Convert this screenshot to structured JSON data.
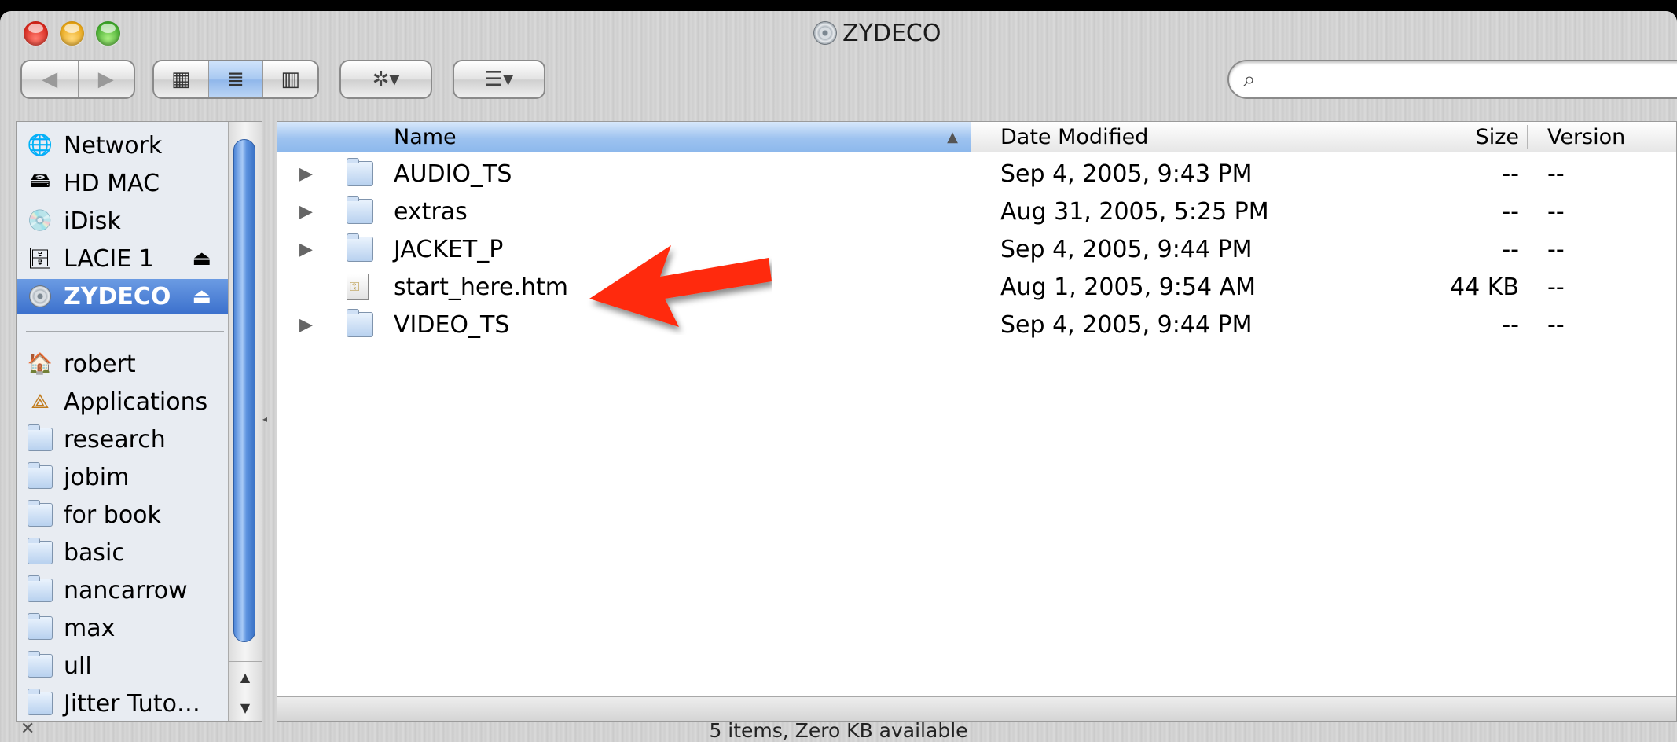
{
  "window": {
    "title": "ZYDECO",
    "status": "5 items, Zero KB available"
  },
  "toolbar": {
    "back_icon": "◀",
    "forward_icon": "▶",
    "icon_view": "▦",
    "list_view": "≣",
    "column_view": "▥",
    "action_icon": "✲▾",
    "arrange_icon": "☰▾",
    "search_placeholder": ""
  },
  "sidebar": {
    "devices": [
      {
        "label": "Network",
        "icon": "network-globe-icon"
      },
      {
        "label": "HD MAC",
        "icon": "hard-drive-icon"
      },
      {
        "label": "iDisk",
        "icon": "idisk-icon"
      },
      {
        "label": "LACIE 1",
        "icon": "usb-drive-icon",
        "eject": "⏏"
      },
      {
        "label": "ZYDECO",
        "icon": "dvd-disc-icon",
        "eject": "⏏",
        "selected": true
      }
    ],
    "places": [
      {
        "label": "robert",
        "icon": "home-icon"
      },
      {
        "label": "Applications",
        "icon": "applications-icon"
      },
      {
        "label": "research",
        "icon": "folder-icon"
      },
      {
        "label": "jobim",
        "icon": "folder-icon"
      },
      {
        "label": "for book",
        "icon": "folder-icon"
      },
      {
        "label": "basic",
        "icon": "folder-icon"
      },
      {
        "label": "nancarrow",
        "icon": "folder-icon"
      },
      {
        "label": "max",
        "icon": "folder-icon"
      },
      {
        "label": "ull",
        "icon": "folder-icon"
      },
      {
        "label": "Jitter Tuto…",
        "icon": "folder-icon"
      }
    ]
  },
  "columns": {
    "name": "Name",
    "date": "Date Modified",
    "size": "Size",
    "version": "Version"
  },
  "files": [
    {
      "name": "AUDIO_TS",
      "date": "Sep 4, 2005, 9:43 PM",
      "size": "--",
      "version": "--",
      "type": "folder"
    },
    {
      "name": "extras",
      "date": "Aug 31, 2005, 5:25 PM",
      "size": "--",
      "version": "--",
      "type": "folder"
    },
    {
      "name": "JACKET_P",
      "date": "Sep 4, 2005, 9:44 PM",
      "size": "--",
      "version": "--",
      "type": "folder"
    },
    {
      "name": "start_here.htm",
      "date": "Aug 1, 2005, 9:54 AM",
      "size": "44 KB",
      "version": "--",
      "type": "file"
    },
    {
      "name": "VIDEO_TS",
      "date": "Sep 4, 2005, 9:44 PM",
      "size": "--",
      "version": "--",
      "type": "folder"
    }
  ],
  "colors": {
    "selection": "#3c71cd",
    "annotation_arrow": "#ff2a0a"
  }
}
